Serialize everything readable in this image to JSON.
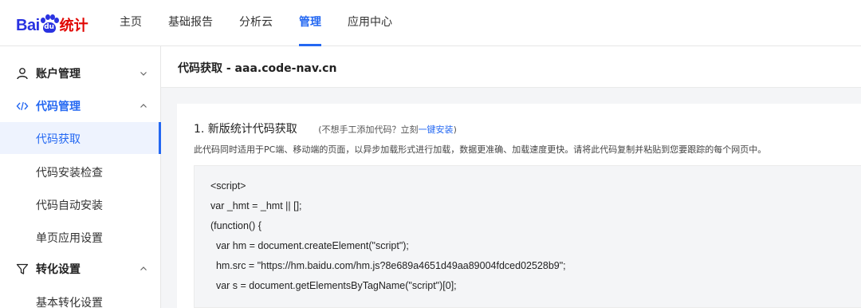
{
  "logo": {
    "bai": "Bai",
    "du": "du",
    "tongji": "统计"
  },
  "topnav": {
    "items": [
      {
        "label": "主页"
      },
      {
        "label": "基础报告"
      },
      {
        "label": "分析云"
      },
      {
        "label": "管理",
        "active": true
      },
      {
        "label": "应用中心"
      }
    ]
  },
  "sidebar": {
    "account": {
      "label": "账户管理",
      "icon": "user-icon"
    },
    "code": {
      "label": "代码管理",
      "icon": "code-icon",
      "children": [
        {
          "label": "代码获取",
          "active": true
        },
        {
          "label": "代码安装检查"
        },
        {
          "label": "代码自动安装"
        },
        {
          "label": "单页应用设置"
        }
      ]
    },
    "conversion": {
      "label": "转化设置",
      "icon": "filter-icon",
      "children": [
        {
          "label": "基本转化设置"
        }
      ]
    }
  },
  "content": {
    "title": "代码获取 - aaa.code-nav.cn",
    "section_title": "1. 新版统计代码获取",
    "hint_prefix": "(不想手工添加代码？立刻",
    "hint_link": "一键安装",
    "hint_suffix": ")",
    "description": "此代码同时适用于PC端、移动端的页面，以异步加载形式进行加载，数据更准确、加载速度更快。请将此代码复制并粘贴到您要跟踪的每个网页中。",
    "code_lines": [
      "<script>",
      "var _hmt = _hmt || [];",
      "(function() {",
      "  var hm = document.createElement(\"script\");",
      "  hm.src = \"https://hm.baidu.com/hm.js?8e689a4651d49aa89004fdced02528b9\";",
      "  var s = document.getElementsByTagName(\"script\")[0];"
    ]
  },
  "colors": {
    "accent": "#2468f2",
    "brand_blue": "#2932e1",
    "brand_red": "#e10602"
  }
}
